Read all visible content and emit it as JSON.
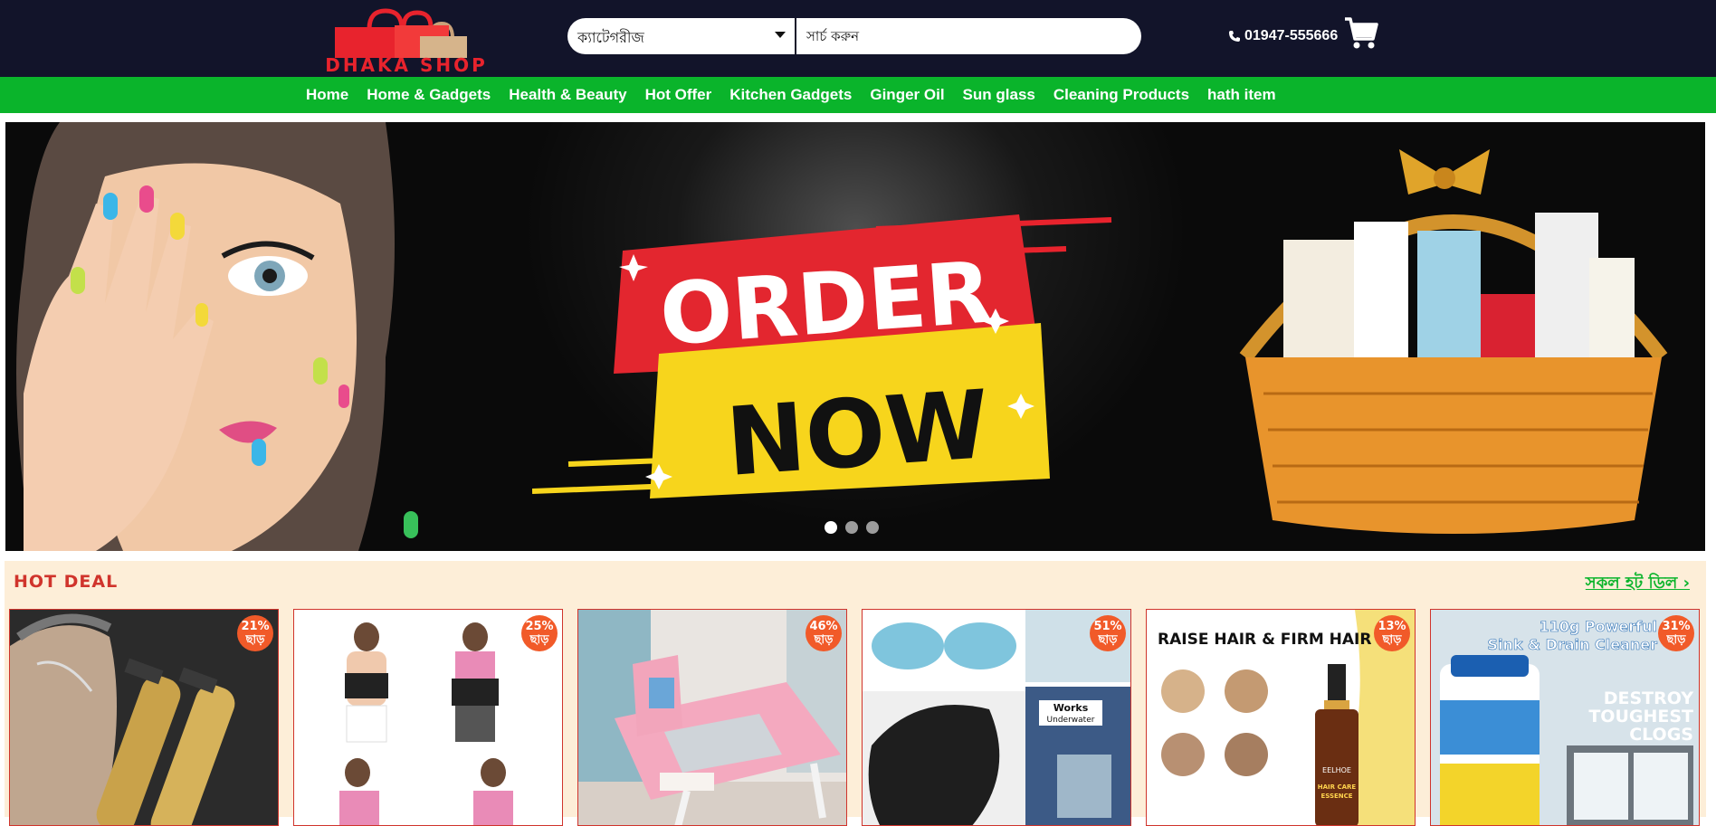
{
  "header": {
    "logo_text": "DHAKA SHOP",
    "category_label": "ক্যাটেগরীজ",
    "search_placeholder": "সার্চ করুন",
    "phone": "01947-555666"
  },
  "nav": {
    "items": [
      {
        "label": "Home"
      },
      {
        "label": "Home & Gadgets"
      },
      {
        "label": "Health & Beauty"
      },
      {
        "label": "Hot Offer"
      },
      {
        "label": "Kitchen Gadgets"
      },
      {
        "label": "Ginger Oil"
      },
      {
        "label": "Sun glass"
      },
      {
        "label": "Cleaning Products"
      },
      {
        "label": "hath item"
      }
    ]
  },
  "banner": {
    "line1": "ORDER",
    "line2": "NOW",
    "slide_count": 3,
    "active_slide": 1
  },
  "hot_deal": {
    "title": "HOT DEAL",
    "view_all": "সকল হট ডিল ›",
    "products": [
      {
        "discount": "21%",
        "discount_label": "ছাড়",
        "image": "hair-trimmer"
      },
      {
        "discount": "25%",
        "discount_label": "ছাড়",
        "image": "waist-trainer"
      },
      {
        "discount": "46%",
        "discount_label": "ছাড়",
        "image": "laptop-table"
      },
      {
        "discount": "51%",
        "discount_label": "ছাড়",
        "image": "waterproof-tape",
        "image_text": "Works Underwater"
      },
      {
        "discount": "13%",
        "discount_label": "ছাড়",
        "image": "hair-essence",
        "image_text": "RAISE HAIR & FIRM HAIR",
        "image_brand": "EELHOE",
        "image_product": "HAIR CARE ESSENCE"
      },
      {
        "discount": "31%",
        "discount_label": "ছাড়",
        "image": "drain-cleaner",
        "image_text": "110g Powerful Sink & Drain Cleaner",
        "image_slogan": "DESTROY TOUGHEST CLOGS"
      }
    ]
  },
  "colors": {
    "header_bg": "#12142a",
    "nav_bg": "#0ab42b",
    "accent_red": "#d0342c",
    "deal_bg": "#fdeed8",
    "badge": "#f15a29"
  }
}
